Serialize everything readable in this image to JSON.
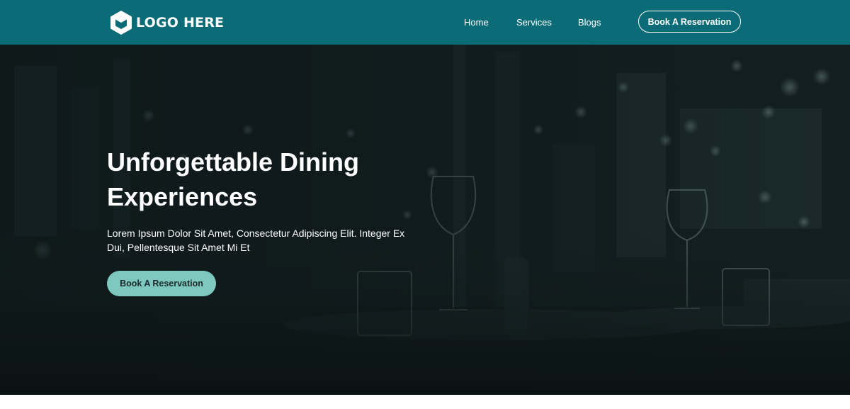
{
  "header": {
    "logo_text": "LOGO HERE",
    "nav": {
      "home": "Home",
      "services": "Services",
      "blogs": "Blogs"
    },
    "cta_label": "Book A Reservation"
  },
  "hero": {
    "title": "Unforgettable Dining Experiences",
    "subtitle": "Lorem Ipsum Dolor Sit Amet, Consectetur Adipiscing Elit. Integer Ex Dui, Pellentesque Sit Amet Mi Et",
    "cta_label": "Book A Reservation"
  },
  "colors": {
    "header_bg": "#0b6c77",
    "hero_button_bg": "#7ec8bf",
    "hero_overlay": "#0f1c1d",
    "text_light": "#ffffff"
  },
  "icons": {
    "logo": "hexagon-cube-icon"
  }
}
